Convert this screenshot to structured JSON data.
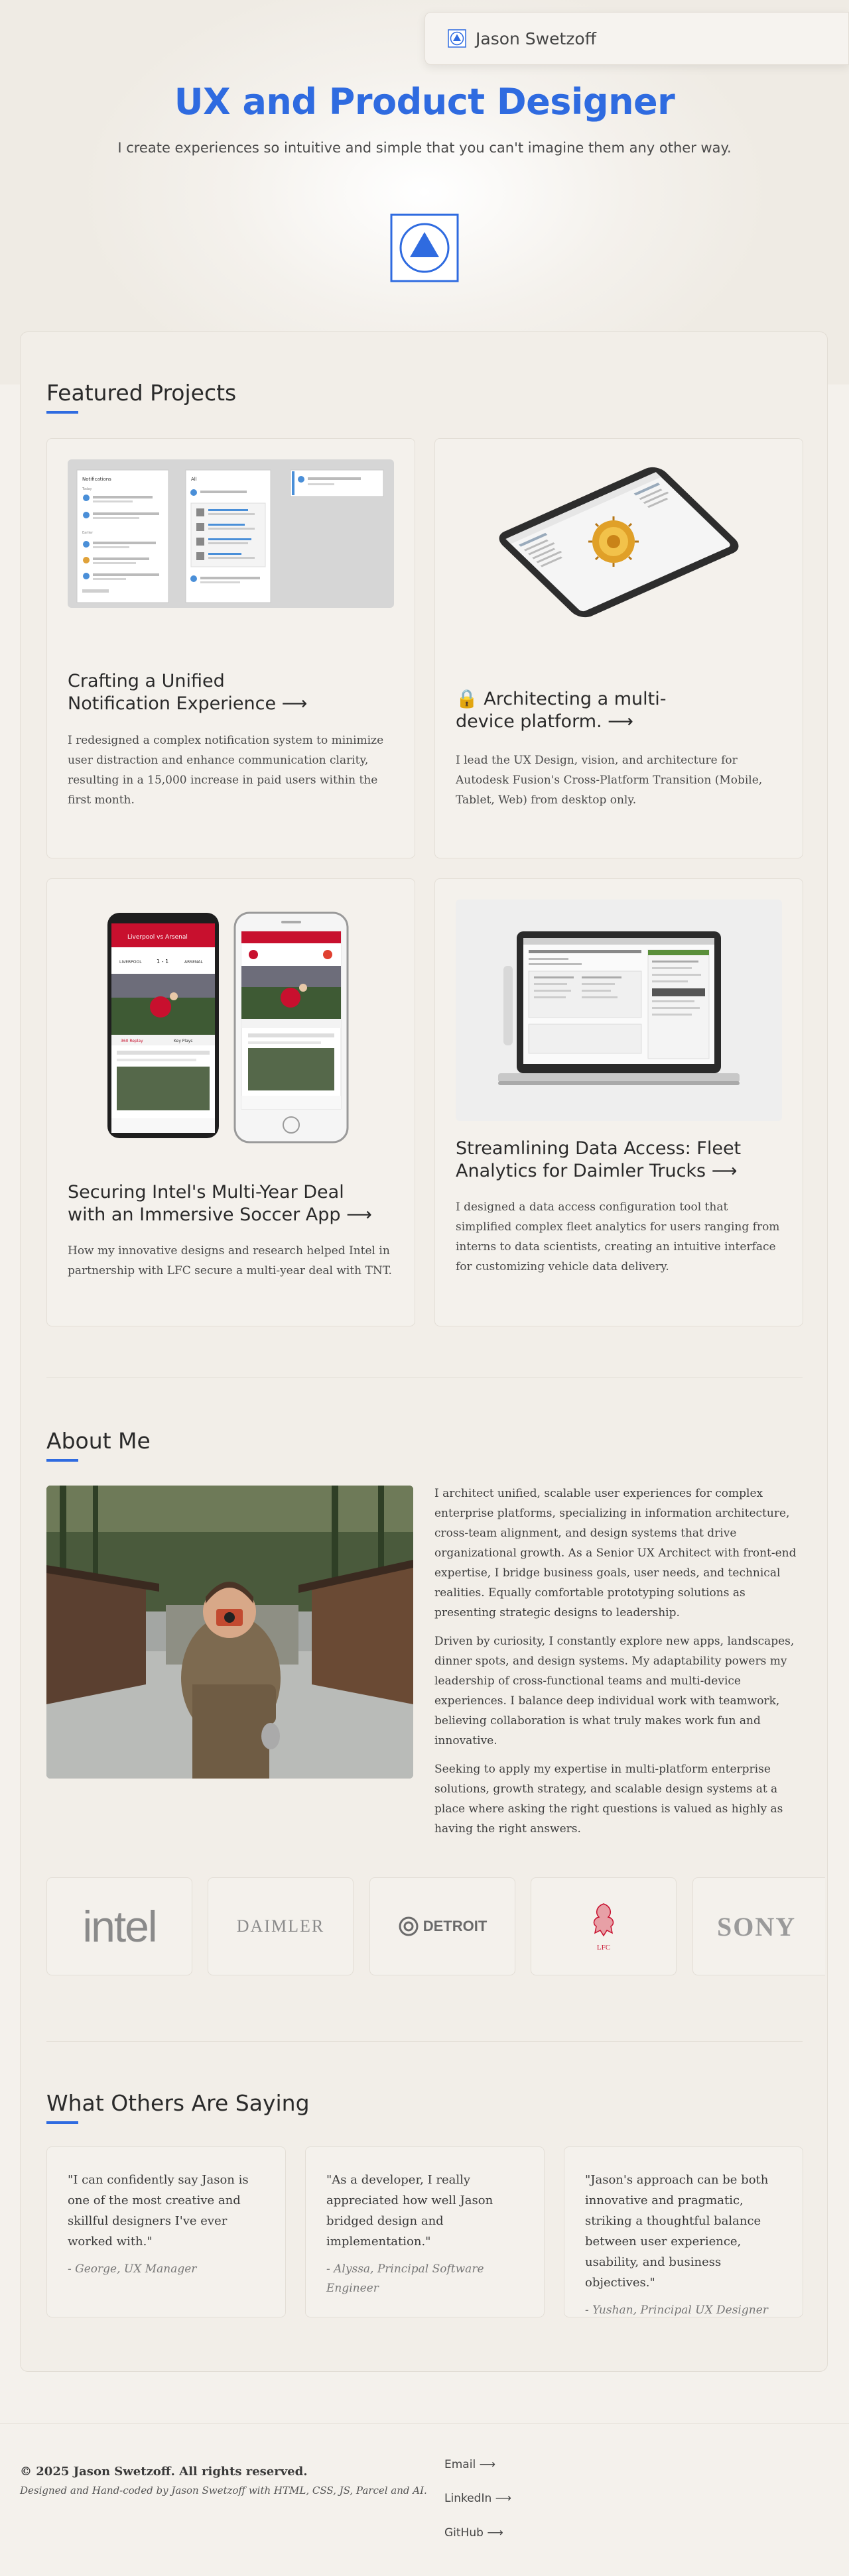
{
  "header": {
    "name": "Jason Swetzoff",
    "logo_icon": "triangle-circle-logo-icon"
  },
  "hero": {
    "title": "UX and Product Designer",
    "subtitle": "I create experiences so intuitive and simple that you can't imagine them any other way.",
    "logo_icon": "triangle-circle-logo-icon"
  },
  "featured": {
    "title": "Featured Projects",
    "projects": [
      {
        "title_line1": "Crafting a Unified",
        "title_line2": "Notification Experience",
        "arrow": "⟶",
        "description": "I redesigned a complex notification system to minimize user distraction and enhance communication clarity, resulting in a 15,000 increase in paid users within the first month."
      },
      {
        "lock": "🔒",
        "title_line1": "Architecting a multi-",
        "title_line2": "device platform.",
        "arrow": "⟶",
        "description": "I lead the UX Design, vision, and architecture for Autodesk Fusion's Cross-Platform Transition (Mobile, Tablet, Web) from desktop only."
      },
      {
        "title_line1": "Securing Intel's Multi-Year Deal",
        "title_line2": "with an Immersive Soccer App",
        "arrow": "⟶",
        "description": "How my innovative designs and research helped Intel in partnership with LFC secure a multi-year deal with TNT."
      },
      {
        "title_line1": "Streamlining Data Access: Fleet",
        "title_line2": "Analytics for Daimler Trucks",
        "arrow": "⟶",
        "description": "I designed a data access configuration tool that simplified complex fleet analytics for users ranging from interns to data scientists, creating an intuitive interface for customizing vehicle data delivery."
      }
    ]
  },
  "mockup_text": {
    "notifications": "Notifications",
    "all": "All",
    "today": "Today",
    "earlier": "Earlier",
    "liverpool_vs_arsenal": "Liverpool vs Arsenal",
    "team1": "LIVERPOOL",
    "team2": "ARSENAL",
    "score": "1 - 1",
    "live": "LIVE",
    "nav1": "360 Replay",
    "nav2": "Key Plays"
  },
  "about": {
    "title": "About Me",
    "paragraphs": [
      "I architect unified, scalable user experiences for complex enterprise platforms, specializing in information architecture, cross-team alignment, and design systems that drive organizational growth. As a Senior UX Architect with front-end expertise, I bridge business goals, user needs, and technical realities. Equally comfortable prototyping solutions as presenting strategic designs to leadership.",
      "Driven by curiosity, I constantly explore new apps, landscapes, dinner spots, and design systems. My adaptability powers my leadership of cross-functional teams and multi-device experiences. I balance deep individual work with teamwork, believing collaboration is what truly makes work fun and innovative.",
      "Seeking to apply my expertise in multi-platform enterprise solutions, growth strategy, and scalable design systems at a place where asking the right questions is valued as highly as having the right answers."
    ]
  },
  "clients": {
    "logos": [
      "intel",
      "DAIMLER",
      "DETROIT",
      "LFC",
      "SONY"
    ]
  },
  "testimonials": {
    "title": "What Others Are Saying",
    "items": [
      {
        "quote": "\"I can confidently say Jason is one of the most creative and skillful designers I've ever worked with.\"",
        "author": "- George, UX Manager"
      },
      {
        "quote": "\"As a developer, I really appreciated how well Jason bridged design and implementation.\"",
        "author": "- Alyssa, Principal Software Engineer"
      },
      {
        "quote": "\"Jason's approach can be both innovative and pragmatic, striking a thoughtful balance between user experience, usability, and business objectives.\"",
        "author": "- Yushan, Principal UX Designer"
      }
    ]
  },
  "footer": {
    "copyright": "© 2025 Jason Swetzoff. All rights reserved.",
    "credit": "Designed and Hand-coded by Jason Swetzoff with HTML, CSS, JS, Parcel and AI.",
    "links": [
      "Email ⟶",
      "LinkedIn ⟶",
      "GitHub ⟶"
    ]
  },
  "colors": {
    "accent": "#2f6be0",
    "background": "#f4f1ec",
    "card": "#f2eee8",
    "lfc_red": "#c8102e"
  }
}
